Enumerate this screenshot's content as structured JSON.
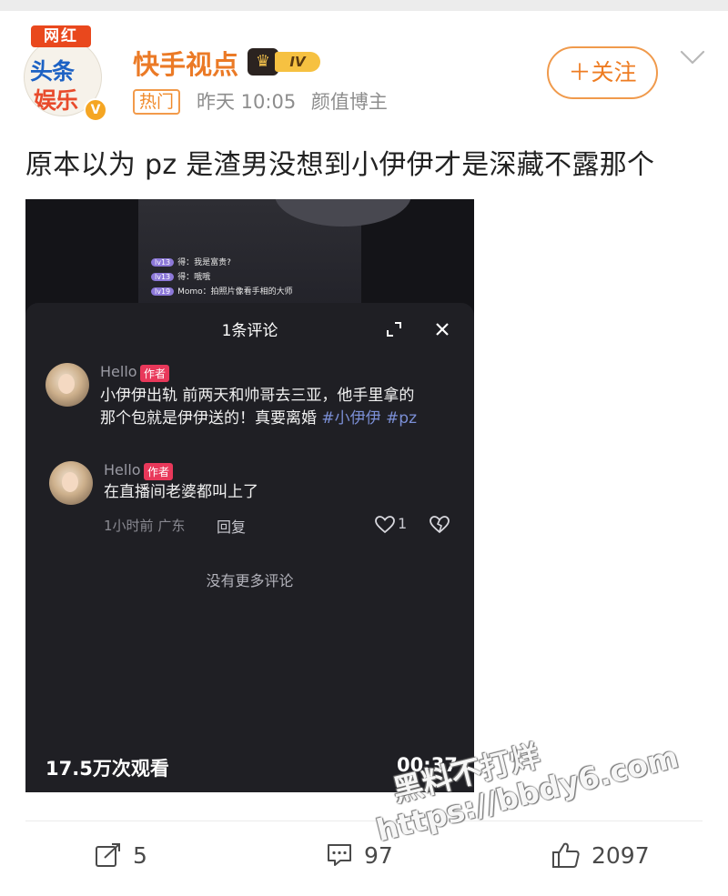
{
  "post": {
    "author": {
      "avatar_badge": "网红",
      "avatar_line1": "头条",
      "avatar_line2": "娱乐",
      "name": "快手视点",
      "vip_level": "IV"
    },
    "hot_tag": "热门",
    "time": "昨天 10:05",
    "source": "颜值博主",
    "follow_label": "＋关注",
    "text": "原本以为 pz 是渣男没想到小伊伊才是深藏不露那个"
  },
  "video": {
    "background_chat": [
      {
        "level": "lv13",
        "text": "得：我是富贵?"
      },
      {
        "level": "lv13",
        "text": "得：哦哦"
      },
      {
        "level": "lv19",
        "text": "Momo：拍照片像看手相的大师"
      }
    ],
    "panel": {
      "title": "1条评论",
      "comments": [
        {
          "user": "Hello",
          "tag": "作者",
          "text_line1": "小伊伊出轨 前两天和帅哥去三亚，他手里拿的",
          "text_line2_plain": "那个包就是伊伊送的！真要离婚 ",
          "hashtags": "#小伊伊 #pz"
        },
        {
          "user": "Hello",
          "tag": "作者",
          "text": "在直播间老婆都叫上了",
          "time": "1小时前",
          "location": "广东",
          "reply_label": "回复",
          "likes": "1"
        }
      ],
      "no_more": "没有更多评论"
    },
    "views": "17.5万次观看",
    "duration": "00:37"
  },
  "actions": {
    "share_count": "5",
    "comment_count": "97",
    "like_count": "2097"
  },
  "watermark": {
    "line1": "黑料不打烊",
    "line2": "https://bbdy6.com"
  },
  "colors": {
    "accent": "#ee7c22",
    "hashtag": "#7b8fd6",
    "author_tag": "#e8385a"
  }
}
